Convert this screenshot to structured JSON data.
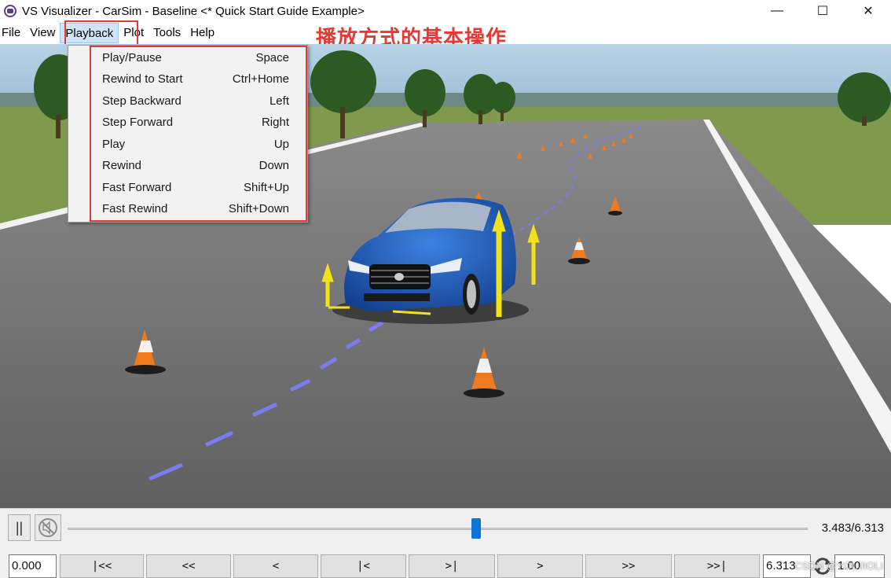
{
  "window": {
    "title": "VS Visualizer - CarSim - Baseline <* Quick Start Guide Example>",
    "minimize_glyph": "—",
    "maximize_glyph": "☐",
    "close_glyph": "✕"
  },
  "menubar": {
    "items": [
      "File",
      "View",
      "Playback",
      "Plot",
      "Tools",
      "Help"
    ],
    "active": "Playback"
  },
  "annotation": "播放方式的基本操作",
  "playback_menu": {
    "items": [
      {
        "label": "Play/Pause",
        "shortcut": "Space"
      },
      {
        "label": "Rewind to Start",
        "shortcut": "Ctrl+Home"
      },
      {
        "label": "Step Backward",
        "shortcut": "Left"
      },
      {
        "label": "Step Forward",
        "shortcut": "Right"
      },
      {
        "label": "Play",
        "shortcut": "Up"
      },
      {
        "label": "Rewind",
        "shortcut": "Down"
      },
      {
        "label": "Fast Forward",
        "shortcut": "Shift+Up"
      },
      {
        "label": "Fast Rewind",
        "shortcut": "Shift+Down"
      }
    ]
  },
  "controls": {
    "pause_glyph": "||",
    "time_readout": "3.483/6.313",
    "slider_fraction": 0.552,
    "start_time": "0.000",
    "nav_buttons": [
      "|<<",
      "<<",
      "<",
      "|<",
      ">|",
      ">",
      ">>",
      ">>|"
    ],
    "end_time": "6.313",
    "speed": "1.00"
  },
  "watermark": "CSDN @YOUJIOLI",
  "colors": {
    "annotation_red": "#e53935",
    "slider_thumb": "#0a74d8",
    "sky": "#a9c8de",
    "road": "#6e6e6e",
    "grass": "#7f9a4c",
    "car_blue": "#1f5fbf",
    "cone_orange": "#f07a1e",
    "path_line": "#7a7cf0"
  }
}
